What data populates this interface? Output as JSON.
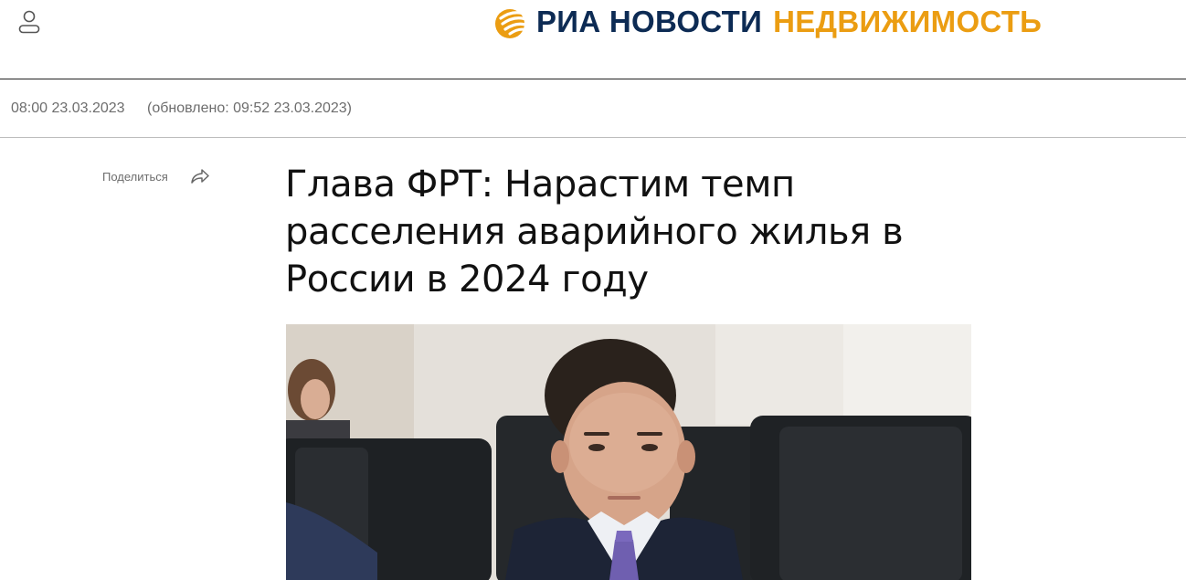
{
  "header": {
    "user_icon": "user-icon",
    "logo": {
      "icon": "ria-logo-icon",
      "brand": "РИА НОВОСТИ",
      "section": "НЕДВИЖИМОСТЬ",
      "brand_color": "#0d2b54",
      "section_color": "#eb9d12"
    }
  },
  "article": {
    "published": "08:00 23.03.2023",
    "updated": "(обновлено: 09:52 23.03.2023)",
    "share_label": "Поделиться",
    "share_icon": "share-icon",
    "title": "Глава ФРТ: Нарастим темп расселения аварийного жилья в России в 2024 году"
  }
}
